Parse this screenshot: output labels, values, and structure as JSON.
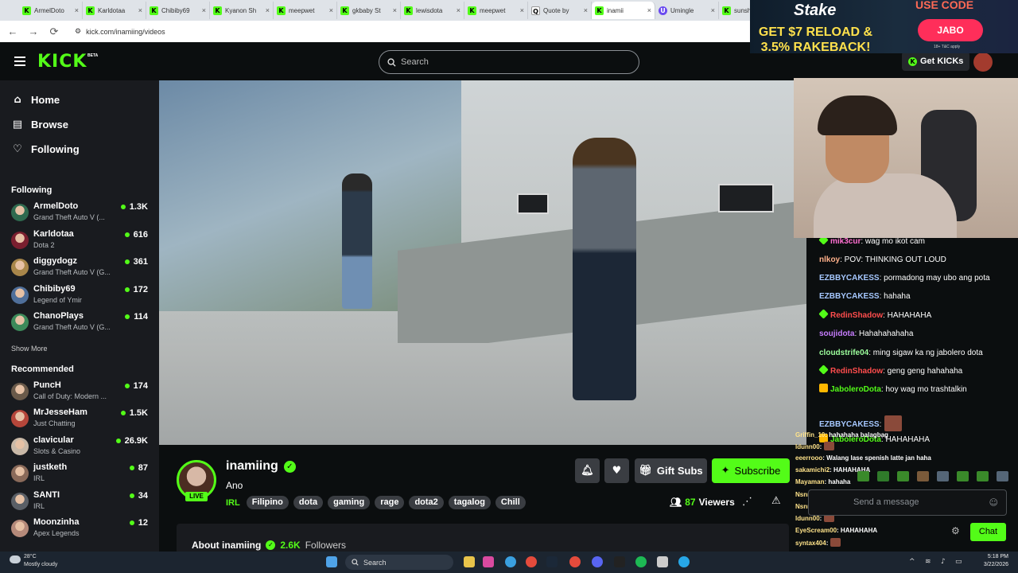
{
  "browser": {
    "tabs": [
      {
        "label": "ArmelDoto",
        "fav": "K"
      },
      {
        "label": "Karldotaa",
        "fav": "K"
      },
      {
        "label": "Chibiby69",
        "fav": "K"
      },
      {
        "label": "Kyanon Sh",
        "fav": "K"
      },
      {
        "label": "meepwet",
        "fav": "K"
      },
      {
        "label": "gkbaby St",
        "fav": "K"
      },
      {
        "label": "lewisdota",
        "fav": "K"
      },
      {
        "label": "meepwet",
        "fav": "K"
      },
      {
        "label": "Quote by",
        "fav": "Q"
      },
      {
        "label": "inamii",
        "fav": "K"
      },
      {
        "label": "Umingle",
        "fav": "U"
      },
      {
        "label": "sunsh",
        "fav": "K"
      }
    ],
    "url": "kick.com/inamiing/videos"
  },
  "ad": {
    "brand": "Stake",
    "line1": "GET $7 RELOAD &",
    "line2": "3.5% RAKEBACK!",
    "use_code": "USE CODE",
    "code": "JABO",
    "fineprint": "18+ T&C apply"
  },
  "header": {
    "logo": "KICK",
    "beta": "BETA",
    "search_placeholder": "Search",
    "get_kicks": "Get KICKs"
  },
  "sidebar": {
    "nav": [
      {
        "label": "Home",
        "icon": "⌂"
      },
      {
        "label": "Browse",
        "icon": "▤"
      },
      {
        "label": "Following",
        "icon": "♡"
      }
    ],
    "following_title": "Following",
    "following": [
      {
        "name": "ArmelDoto",
        "game": "Grand Theft Auto V (...",
        "viewers": "1.3K",
        "color": "#2f6a4f"
      },
      {
        "name": "Karldotaa",
        "game": "Dota 2",
        "viewers": "616",
        "color": "#7a1f2f"
      },
      {
        "name": "diggydogz",
        "game": "Grand Theft Auto V (G...",
        "viewers": "361",
        "color": "#a8864a"
      },
      {
        "name": "Chibiby69",
        "game": "Legend of Ymir",
        "viewers": "172",
        "color": "#4f6f9a"
      },
      {
        "name": "ChanoPlays",
        "game": "Grand Theft Auto V (G...",
        "viewers": "114",
        "color": "#3c8a5a"
      }
    ],
    "show_more": "Show More",
    "recommended_title": "Recommended",
    "recommended": [
      {
        "name": "PuncH",
        "game": "Call of Duty: Modern ...",
        "viewers": "174",
        "color": "#6a5a4a"
      },
      {
        "name": "MrJesseHam",
        "game": "Just Chatting",
        "viewers": "1.5K",
        "color": "#b5463a"
      },
      {
        "name": "clavicular",
        "game": "Slots & Casino",
        "viewers": "26.9K",
        "color": "#c9b9a8"
      },
      {
        "name": "justketh",
        "game": "IRL",
        "viewers": "87",
        "color": "#8a6a5a"
      },
      {
        "name": "SANTI",
        "game": "IRL",
        "viewers": "34",
        "color": "#5a5f66"
      },
      {
        "name": "Moonzinha",
        "game": "Apex Legends",
        "viewers": "12",
        "color": "#b58a7a"
      }
    ]
  },
  "channel": {
    "name": "inamiing",
    "live": "LIVE",
    "title": "Ano",
    "category": "IRL",
    "tags": [
      "Filipino",
      "dota",
      "gaming",
      "rage",
      "dota2",
      "tagalog",
      "Chill"
    ],
    "gift_subs": "Gift Subs",
    "subscribe": "Subscribe",
    "viewers_num": "87",
    "viewers_label": "Viewers",
    "about": "About inamiing",
    "followers_num": "2.6K",
    "followers_label": "Followers"
  },
  "chat": {
    "messages": [
      {
        "user": "mik3cur",
        "text": ": wag mo ikot cam",
        "color": "#ff6fd0",
        "badge": "#53fc18"
      },
      {
        "user": "nlkoy",
        "text": ": POV: THINKING OUT LOUD",
        "color": "#ffb08a",
        "badge": ""
      },
      {
        "user": "EZBBYCAKESS",
        "text": ": pormadong may ubo ang pota",
        "color": "#a6c8ff",
        "badge": ""
      },
      {
        "user": "EZBBYCAKESS",
        "text": ": hahaha",
        "color": "#a6c8ff",
        "badge": ""
      },
      {
        "user": "RedinShadow",
        "text": ": HAHAHAHA",
        "color": "#ff4d4d",
        "badge": "#53fc18"
      },
      {
        "user": "soujidota",
        "text": ": Hahahahahaha",
        "color": "#c77dff",
        "badge": ""
      },
      {
        "user": "cloudstrife04",
        "text": ": ming sigaw ka ng jabolero dota",
        "color": "#9dff9d",
        "badge": ""
      },
      {
        "user": "RedinShadow",
        "text": ": geng geng hahahaha",
        "color": "#ff4d4d",
        "badge": "#53fc18"
      },
      {
        "user": "JaboleroDota",
        "text": ": hoy wag mo trashtalkin",
        "color": "#53fc18",
        "badge": "#ffb800"
      },
      {
        "user": "EZBBYCAKESS",
        "text": ":",
        "color": "#a6c8ff",
        "badge": ""
      },
      {
        "user": "JaboleroDota",
        "text": ": HAHAHAHA",
        "color": "#53fc18",
        "badge": "#ffb800"
      }
    ],
    "overlay": [
      {
        "user": "Griffin_10",
        "text": ": hahahaha balagbag"
      },
      {
        "user": "ldunn00",
        "text": ":"
      },
      {
        "user": "eeerrooo",
        "text": ": Walang lase spenish latte jan haha"
      },
      {
        "user": "sakamichi2",
        "text": ": HAHAHAHA"
      },
      {
        "user": "Mayaman",
        "text": ": hahaha"
      },
      {
        "user": "Nsnnnaj",
        "text": ":"
      },
      {
        "user": "Nsnnnaj",
        "text": ":"
      },
      {
        "user": "ldunn00",
        "text": ":"
      },
      {
        "user": "EyeScream00",
        "text": ": HAHAHAHA"
      },
      {
        "user": "syntax404",
        "text": ":"
      }
    ],
    "placeholder": "Send a message",
    "chat_button": "Chat"
  },
  "taskbar": {
    "temp": "28°C",
    "weather": "Mostly cloudy",
    "search": "Search",
    "time": "5:18 PM",
    "date": "3/22/2026"
  }
}
